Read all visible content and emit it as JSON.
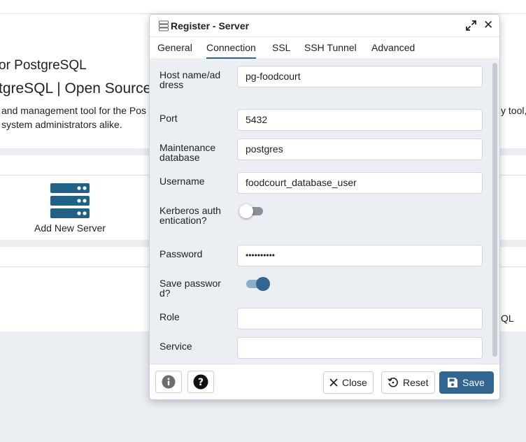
{
  "background": {
    "title_line1": "or PostgreSQL",
    "title_line2": "tgreSQL | Open Source",
    "description_line1": "and management tool for the Pos",
    "description_line2": "system administrators alike.",
    "description_right": "y tool,",
    "quick_link_label": "Add New Server",
    "right_fragment": "QL"
  },
  "dialog": {
    "title": "Register - Server",
    "tabs": [
      {
        "label": "General",
        "active": false
      },
      {
        "label": "Connection",
        "active": true
      },
      {
        "label": "SSL",
        "active": false
      },
      {
        "label": "SSH Tunnel",
        "active": false
      },
      {
        "label": "Advanced",
        "active": false
      }
    ],
    "fields": {
      "host": {
        "label": "Host name/address",
        "value": "pg-foodcourt"
      },
      "port": {
        "label": "Port",
        "value": "5432"
      },
      "maintenance_db": {
        "label": "Maintenance database",
        "value": "postgres"
      },
      "username": {
        "label": "Username",
        "value": "foodcourt_database_user"
      },
      "kerberos": {
        "label": "Kerberos authentication?",
        "enabled": false
      },
      "password": {
        "label": "Password",
        "value": "••••••••••"
      },
      "save_password": {
        "label": "Save password?",
        "enabled": true
      },
      "role": {
        "label": "Role",
        "value": ""
      },
      "service": {
        "label": "Service",
        "value": ""
      }
    },
    "footer": {
      "close_label": "Close",
      "reset_label": "Reset",
      "save_label": "Save"
    }
  },
  "colors": {
    "accent": "#326690",
    "background": "#ebeef3"
  }
}
